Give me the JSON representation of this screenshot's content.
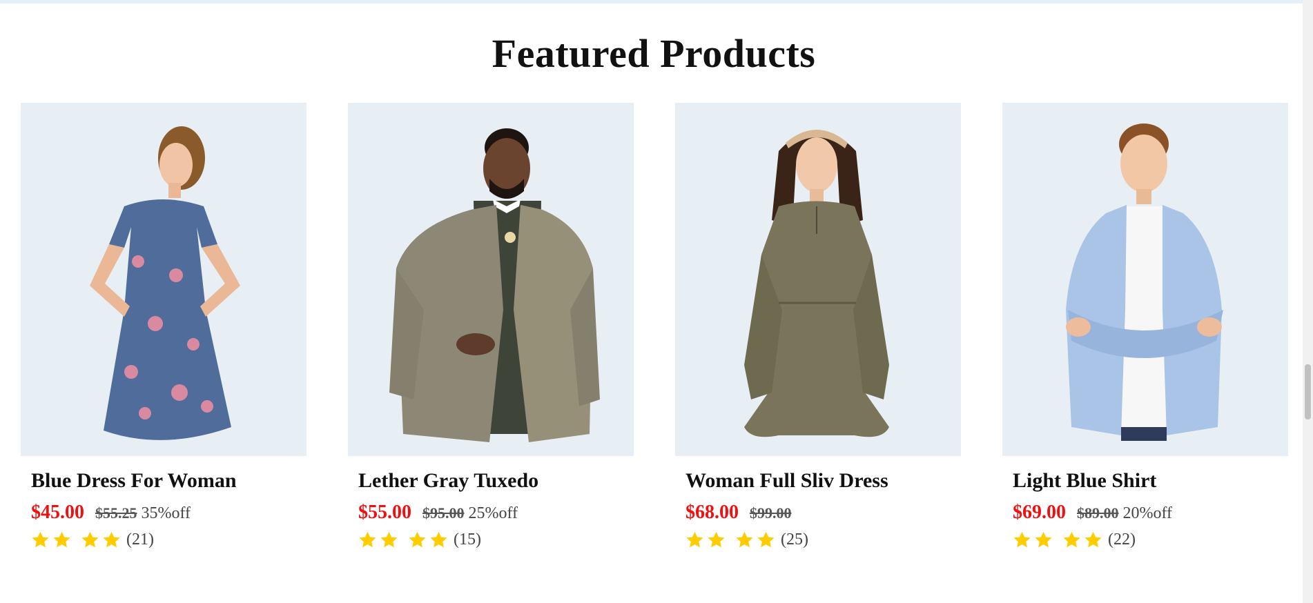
{
  "section": {
    "title": "Featured Products"
  },
  "products": [
    {
      "name": "Blue Dress For Woman",
      "price": "$45.00",
      "old_price": "$55.25",
      "discount": "35%off",
      "review_count": "(21)",
      "stars": 4,
      "image_icon": "woman-floral-dress-photo"
    },
    {
      "name": "Lether Gray Tuxedo",
      "price": "$55.00",
      "old_price": "$95.00",
      "discount": "25%off",
      "review_count": "(15)",
      "stars": 4,
      "image_icon": "man-tweed-jacket-photo"
    },
    {
      "name": "Woman Full Sliv Dress",
      "price": "$68.00",
      "old_price": "$99.00",
      "discount": "",
      "review_count": "(25)",
      "stars": 4,
      "image_icon": "woman-olive-dress-photo"
    },
    {
      "name": "Light Blue Shirt",
      "price": "$69.00",
      "old_price": "$89.00",
      "discount": "20%off",
      "review_count": "(22)",
      "stars": 4,
      "image_icon": "boy-blue-shirt-photo"
    }
  ],
  "colors": {
    "price": "#ee1111",
    "star": "#ffcc00",
    "image_bg": "#e8eff4"
  }
}
